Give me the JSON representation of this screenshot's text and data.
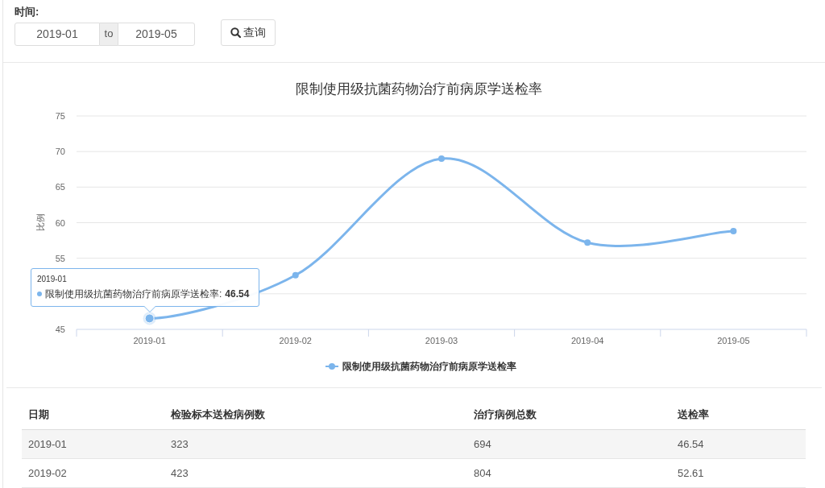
{
  "filter": {
    "label": "时间:",
    "from": "2019-01",
    "separator": "to",
    "to": "2019-05",
    "button": "查询"
  },
  "chart": {
    "chart_data": {
      "type": "line",
      "title": "限制使用级抗菌药物治疗前病原学送检率",
      "ylabel": "比例",
      "categories": [
        "2019-01",
        "2019-02",
        "2019-03",
        "2019-04",
        "2019-05"
      ],
      "ylim": [
        45,
        75
      ],
      "yticks": [
        45,
        55,
        60,
        65,
        70,
        75
      ],
      "grid": true,
      "series": [
        {
          "name": "限制使用级抗菌药物治疗前病原学送检率",
          "color": "#7cb5ec",
          "marker": "circle",
          "values": [
            46.54,
            52.61,
            69.0,
            57.2,
            58.8
          ]
        }
      ]
    },
    "tooltip": {
      "header": "2019-01",
      "label": "限制使用级抗菌药物治疗前病原学送检率:",
      "value": "46.54"
    }
  },
  "table": {
    "columns": [
      "日期",
      "检验标本送检病例数",
      "治疗病例总数",
      "送检率"
    ],
    "rows": [
      [
        "2019-01",
        "323",
        "694",
        "46.54"
      ],
      [
        "2019-02",
        "423",
        "804",
        "52.61"
      ]
    ]
  }
}
